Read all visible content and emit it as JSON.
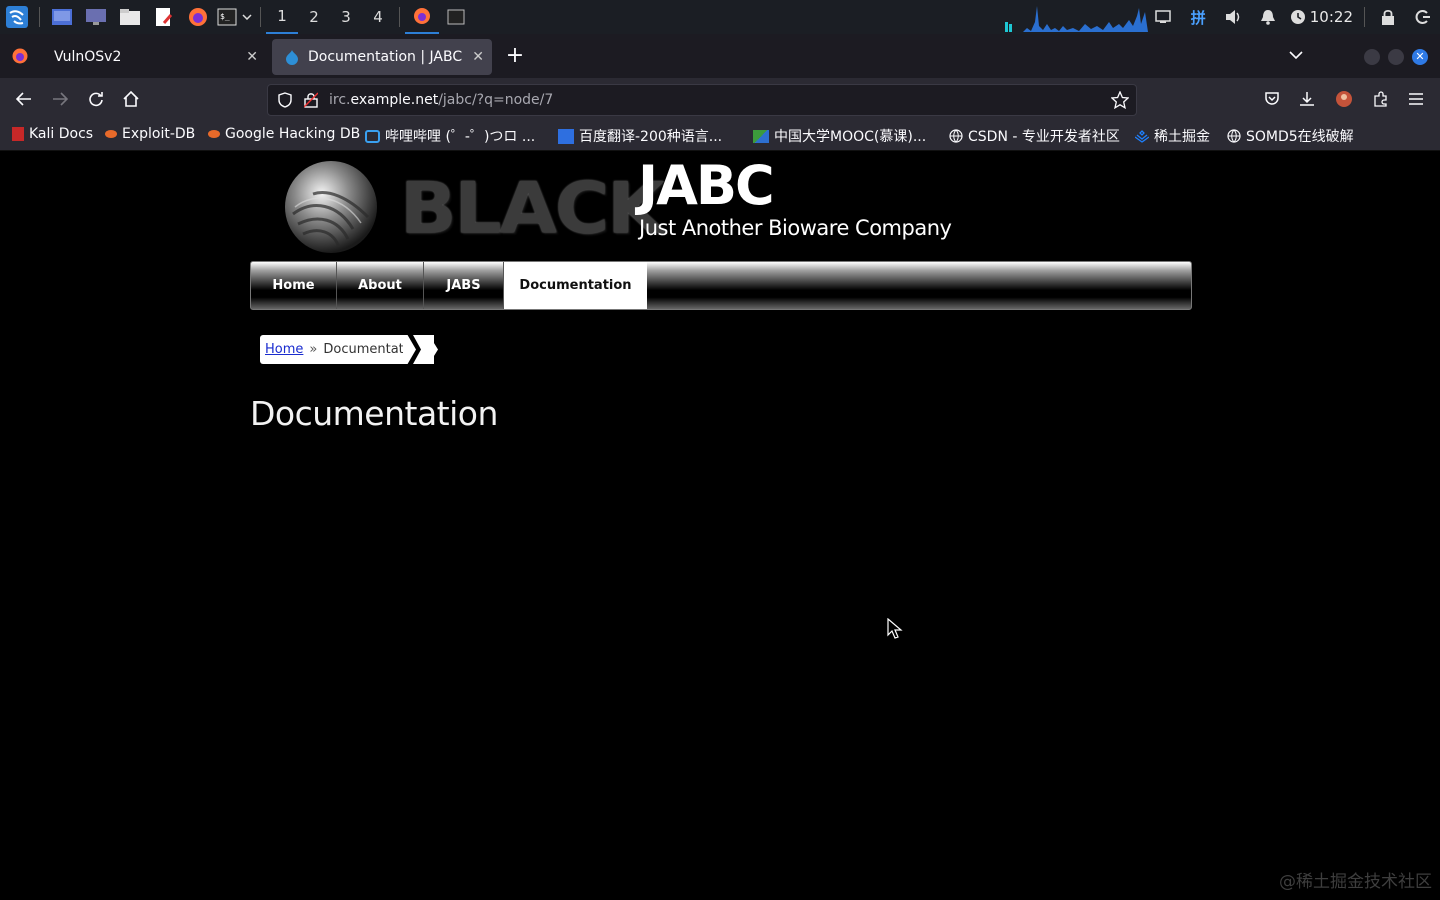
{
  "taskbar": {
    "workspaces": [
      "1",
      "2",
      "3",
      "4"
    ],
    "clock": "10:22",
    "tray_ime": "拼"
  },
  "browser": {
    "tabs": [
      {
        "title": "VulnOSv2"
      },
      {
        "title": "Documentation | JABC"
      }
    ],
    "url_prefix": "irc.",
    "url_host": "example.net",
    "url_path": "/jabc/?q=node/7",
    "bookmarks": [
      {
        "label": "Kali Docs"
      },
      {
        "label": "Exploit-DB"
      },
      {
        "label": "Google Hacking DB"
      },
      {
        "label": "哔哩哔哩 (゜-゜)つロ ..."
      },
      {
        "label": "百度翻译-200种语言..."
      },
      {
        "label": "中国大学MOOC(慕课)..."
      },
      {
        "label": "CSDN - 专业开发者社区"
      },
      {
        "label": "稀土掘金"
      },
      {
        "label": "SOMD5在线破解"
      }
    ]
  },
  "site": {
    "logo_text": "BLACK",
    "name": "JABC",
    "slogan": "Just Another Bioware Company",
    "menu": [
      {
        "label": "Home"
      },
      {
        "label": "About"
      },
      {
        "label": "JABS"
      },
      {
        "label": "Documentation"
      }
    ],
    "breadcrumb": {
      "home": "Home",
      "separator": "»",
      "current": "Documentation"
    },
    "page_title": "Documentation"
  },
  "watermark": "@稀土掘金技术社区",
  "colors": {
    "accent": "#2d7fd6",
    "link": "#1a2ccf"
  }
}
